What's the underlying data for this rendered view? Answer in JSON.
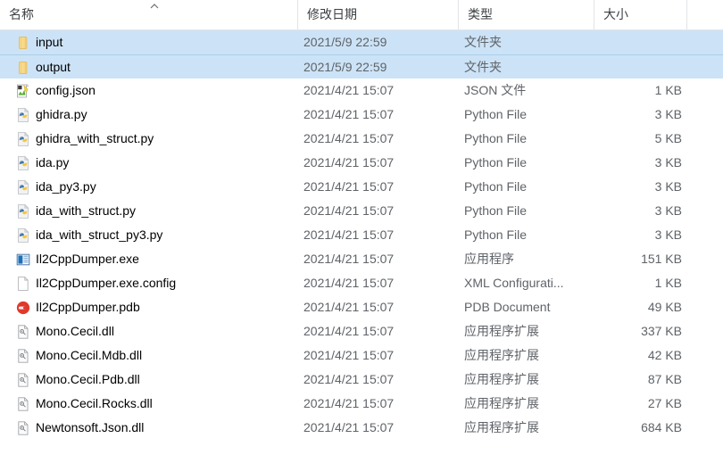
{
  "columns": [
    {
      "key": "name",
      "label": "名称",
      "sorted": true,
      "sort_direction": "ascending"
    },
    {
      "key": "date",
      "label": "修改日期"
    },
    {
      "key": "type",
      "label": "类型"
    },
    {
      "key": "size",
      "label": "大小"
    }
  ],
  "header": {
    "name_label": "名称",
    "date_label": "修改日期",
    "type_label": "类型",
    "size_label": "大小",
    "sort_icon": "caret-up-icon"
  },
  "colors": {
    "selection": "#cce3f7",
    "selection_border": "#a9cdea",
    "header_text": "#3c4043",
    "secondary_text": "#5f6368",
    "background": "#ffffff",
    "folder_icon": "#f5c860",
    "python_blue": "#306998",
    "python_yellow": "#ffd43b",
    "pdb_red": "#e03c31",
    "exe_blue": "#1d6fb8",
    "json_green": "#6cbf3c"
  },
  "rows": [
    {
      "icon": "folder-icon",
      "name": "input",
      "date": "2021/5/9 22:59",
      "type": "文件夹",
      "size": "",
      "selected": true
    },
    {
      "icon": "folder-icon",
      "name": "output",
      "date": "2021/5/9 22:59",
      "type": "文件夹",
      "size": "",
      "selected": true
    },
    {
      "icon": "json-file-icon",
      "name": "config.json",
      "date": "2021/4/21 15:07",
      "type": "JSON 文件",
      "size": "1 KB",
      "selected": false
    },
    {
      "icon": "python-file-icon",
      "name": "ghidra.py",
      "date": "2021/4/21 15:07",
      "type": "Python File",
      "size": "3 KB",
      "selected": false
    },
    {
      "icon": "python-file-icon",
      "name": "ghidra_with_struct.py",
      "date": "2021/4/21 15:07",
      "type": "Python File",
      "size": "5 KB",
      "selected": false
    },
    {
      "icon": "python-file-icon",
      "name": "ida.py",
      "date": "2021/4/21 15:07",
      "type": "Python File",
      "size": "3 KB",
      "selected": false
    },
    {
      "icon": "python-file-icon",
      "name": "ida_py3.py",
      "date": "2021/4/21 15:07",
      "type": "Python File",
      "size": "3 KB",
      "selected": false
    },
    {
      "icon": "python-file-icon",
      "name": "ida_with_struct.py",
      "date": "2021/4/21 15:07",
      "type": "Python File",
      "size": "3 KB",
      "selected": false
    },
    {
      "icon": "python-file-icon",
      "name": "ida_with_struct_py3.py",
      "date": "2021/4/21 15:07",
      "type": "Python File",
      "size": "3 KB",
      "selected": false
    },
    {
      "icon": "application-icon",
      "name": "Il2CppDumper.exe",
      "date": "2021/4/21 15:07",
      "type": "应用程序",
      "size": "151 KB",
      "selected": false
    },
    {
      "icon": "blank-page-icon",
      "name": "Il2CppDumper.exe.config",
      "date": "2021/4/21 15:07",
      "type": "XML Configurati...",
      "size": "1 KB",
      "selected": false
    },
    {
      "icon": "pdb-file-icon",
      "name": "Il2CppDumper.pdb",
      "date": "2021/4/21 15:07",
      "type": "PDB Document",
      "size": "49 KB",
      "selected": false
    },
    {
      "icon": "dll-file-icon",
      "name": "Mono.Cecil.dll",
      "date": "2021/4/21 15:07",
      "type": "应用程序扩展",
      "size": "337 KB",
      "selected": false
    },
    {
      "icon": "dll-file-icon",
      "name": "Mono.Cecil.Mdb.dll",
      "date": "2021/4/21 15:07",
      "type": "应用程序扩展",
      "size": "42 KB",
      "selected": false
    },
    {
      "icon": "dll-file-icon",
      "name": "Mono.Cecil.Pdb.dll",
      "date": "2021/4/21 15:07",
      "type": "应用程序扩展",
      "size": "87 KB",
      "selected": false
    },
    {
      "icon": "dll-file-icon",
      "name": "Mono.Cecil.Rocks.dll",
      "date": "2021/4/21 15:07",
      "type": "应用程序扩展",
      "size": "27 KB",
      "selected": false
    },
    {
      "icon": "dll-file-icon",
      "name": "Newtonsoft.Json.dll",
      "date": "2021/4/21 15:07",
      "type": "应用程序扩展",
      "size": "684 KB",
      "selected": false
    }
  ]
}
